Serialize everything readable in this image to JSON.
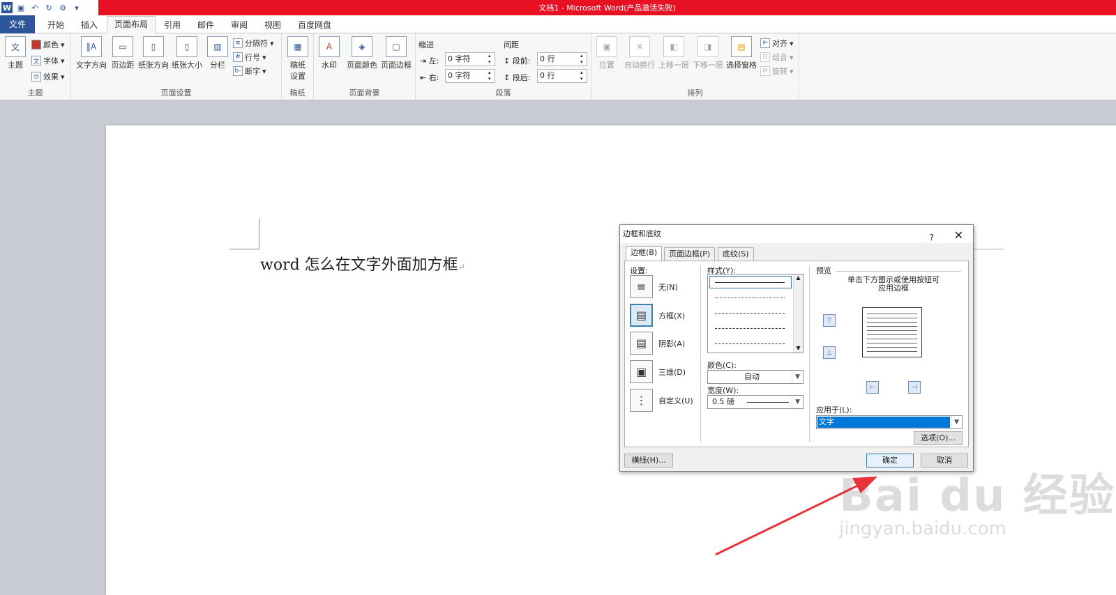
{
  "window": {
    "title": "文档1 - Microsoft Word(产品激活失败)"
  },
  "tabs": [
    "文件",
    "开始",
    "插入",
    "页面布局",
    "引用",
    "邮件",
    "审阅",
    "视图",
    "百度网盘"
  ],
  "ribbon": {
    "theme": {
      "btn": "主题",
      "colors": "颜色",
      "fonts": "字体",
      "effects": "效果",
      "label": "主题"
    },
    "page_setup": {
      "text_dir": "文字方向",
      "margins": "页边距",
      "orientation": "纸张方向",
      "size": "纸张大小",
      "columns": "分栏",
      "breaks": "分隔符",
      "line_numbers": "行号",
      "hyphenation": "断字",
      "label": "页面设置"
    },
    "draft": {
      "btn": "稿纸\n设置",
      "label": "稿纸"
    },
    "page_bg": {
      "watermark": "水印",
      "page_color": "页面颜色",
      "page_borders": "页面边框",
      "label": "页面背景"
    },
    "paragraph": {
      "indent": "缩进",
      "left": "左:",
      "left_val": "0 字符",
      "right": "右:",
      "right_val": "0 字符",
      "spacing": "间距",
      "before": "段前:",
      "before_val": "0 行",
      "after": "段后:",
      "after_val": "0 行",
      "label": "段落"
    },
    "arrange": {
      "position": "位置",
      "wrap": "自动换行",
      "forward": "上移一层",
      "backward": "下移一层",
      "pane": "选择窗格",
      "align": "对齐",
      "group": "组合",
      "rotate": "旋转",
      "label": "排列"
    }
  },
  "document": {
    "text": "word 怎么在文字外面加方框",
    "para_mark": "↵"
  },
  "dialog": {
    "title": "边框和底纹",
    "help": "?",
    "close": "✕",
    "tabs": [
      "边框(B)",
      "页面边框(P)",
      "底纹(S)"
    ],
    "setting_label": "设置:",
    "settings": [
      "无(N)",
      "方框(X)",
      "阴影(A)",
      "三维(D)",
      "自定义(U)"
    ],
    "style_label": "样式(Y):",
    "color_label": "颜色(C):",
    "color_val": "自动",
    "width_label": "宽度(W):",
    "width_val": "0.5 磅",
    "preview_label": "预览",
    "preview_hint": "单击下方图示或使用按钮可\n应用边框",
    "apply_label": "应用于(L):",
    "apply_val": "文字",
    "options_btn": "选项(O)...",
    "hline_btn": "横线(H)...",
    "ok_btn": "确定",
    "cancel_btn": "取消"
  },
  "watermark": {
    "big": "Bai du 经验",
    "small": "jingyan.baidu.com"
  },
  "colors": {
    "accent": "#2b579a",
    "titlebar": "#e81123",
    "arrow": "#e8323a"
  }
}
